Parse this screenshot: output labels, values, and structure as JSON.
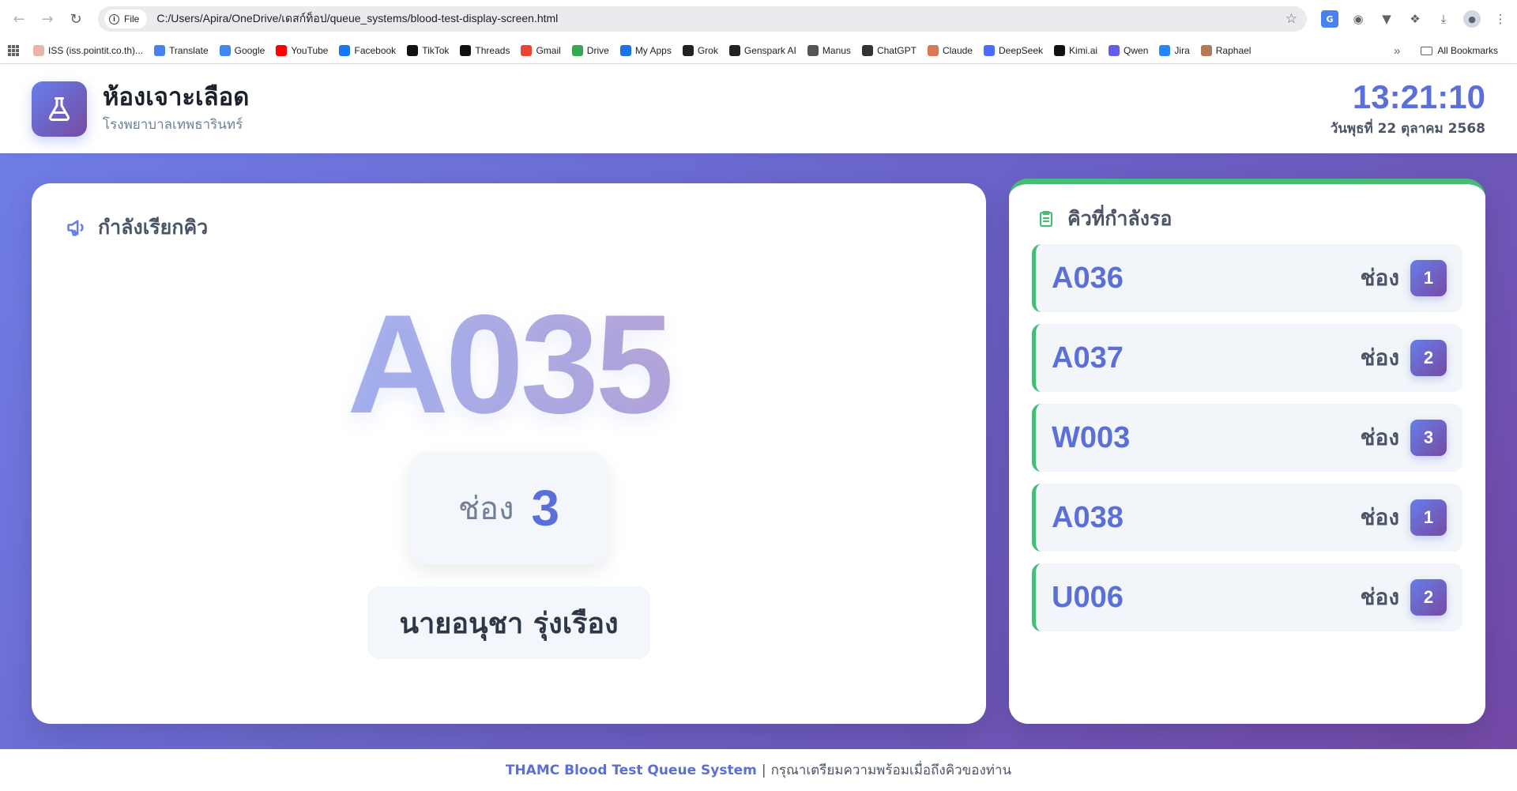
{
  "browser": {
    "protocol_label": "File",
    "url": "C:/Users/Apira/OneDrive/เดสก์ท็อป/queue_systems/blood-test-display-screen.html",
    "bookmarks": [
      {
        "label": "ISS (iss.pointit.co.th)...",
        "icon": "iss-icon",
        "color": "#e8b7a8"
      },
      {
        "label": "Translate",
        "icon": "translate-icon",
        "color": "#4a80ef"
      },
      {
        "label": "Google",
        "icon": "google-icon",
        "color": "#4285f4"
      },
      {
        "label": "YouTube",
        "icon": "youtube-icon",
        "color": "#ff0000"
      },
      {
        "label": "Facebook",
        "icon": "facebook-icon",
        "color": "#1877f2"
      },
      {
        "label": "TikTok",
        "icon": "tiktok-icon",
        "color": "#111111"
      },
      {
        "label": "Threads",
        "icon": "threads-icon",
        "color": "#111111"
      },
      {
        "label": "Gmail",
        "icon": "gmail-icon",
        "color": "#ea4335"
      },
      {
        "label": "Drive",
        "icon": "drive-icon",
        "color": "#34a853"
      },
      {
        "label": "My Apps",
        "icon": "myapps-icon",
        "color": "#1a73e8"
      },
      {
        "label": "Grok",
        "icon": "grok-icon",
        "color": "#222222"
      },
      {
        "label": "Genspark AI",
        "icon": "genspark-icon",
        "color": "#222222"
      },
      {
        "label": "Manus",
        "icon": "manus-icon",
        "color": "#555555"
      },
      {
        "label": "ChatGPT",
        "icon": "chatgpt-icon",
        "color": "#333333"
      },
      {
        "label": "Claude",
        "icon": "claude-icon",
        "color": "#d97757"
      },
      {
        "label": "DeepSeek",
        "icon": "deepseek-icon",
        "color": "#4d6bfe"
      },
      {
        "label": "Kimi.ai",
        "icon": "kimi-icon",
        "color": "#111111"
      },
      {
        "label": "Qwen",
        "icon": "qwen-icon",
        "color": "#615ced"
      },
      {
        "label": "Jira",
        "icon": "jira-icon",
        "color": "#2684ff"
      },
      {
        "label": "Raphael",
        "icon": "raphael-icon",
        "color": "#b07a5a"
      }
    ],
    "all_bookmarks_label": "All Bookmarks"
  },
  "header": {
    "title": "ห้องเจาะเลือด",
    "subtitle": "โรงพยาบาลเทพธารินทร์",
    "time": "13:21:10",
    "date": "วันพุธที่ 22 ตุลาคม 2568"
  },
  "current": {
    "heading": "กำลังเรียกคิว",
    "queue_number": "A035",
    "counter_label": "ช่อง",
    "counter_number": "3",
    "patient_name": "นายอนุชา รุ่งเรือง"
  },
  "waiting": {
    "heading": "คิวที่กำลังรอ",
    "counter_label": "ช่อง",
    "items": [
      {
        "number": "A036",
        "counter": "1"
      },
      {
        "number": "A037",
        "counter": "2"
      },
      {
        "number": "W003",
        "counter": "3"
      },
      {
        "number": "A038",
        "counter": "1"
      },
      {
        "number": "U006",
        "counter": "2"
      }
    ]
  },
  "footer": {
    "brand": "THAMC Blood Test Queue System",
    "separator": "|",
    "message": "กรุณาเตรียมความพร้อมเมื่อถึงคิวของท่าน"
  },
  "colors": {
    "accent": "#5a6fd8",
    "gradient_start": "#667eea",
    "gradient_end": "#764ba2",
    "waiting_accent": "#48bb78"
  }
}
